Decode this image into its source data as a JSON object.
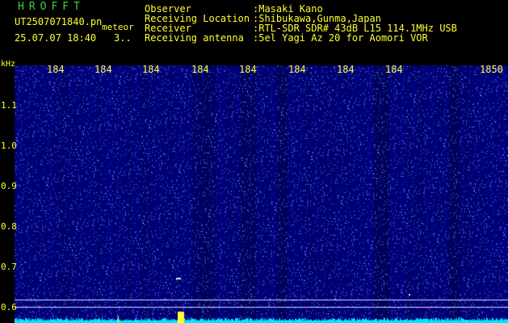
{
  "header": {
    "title": "HROFFT",
    "file_name": "UT2507071840.pn",
    "mode": "meteor",
    "datetime": "25.07.07 18:40",
    "count": "3..",
    "fields": [
      {
        "label": "Observer",
        "value": ":Masaki Kano"
      },
      {
        "label": "Receiving Location",
        "value": ":Shibukawa,Gunma,Japan"
      },
      {
        "label": "Receiver",
        "value": ":RTL-SDR SDR# 43dB L15 114.1MHz USB"
      },
      {
        "label": "Receiving antenna",
        "value": ":5el Yagi Az 20 for Aomori VOR"
      }
    ]
  },
  "axes": {
    "y_unit": "kHz",
    "x_ticks": [
      "184",
      "184",
      "184",
      "184",
      "184",
      "184",
      "184",
      "184",
      "1850"
    ],
    "y_ticks": [
      "1.1",
      "1.0",
      "0.9",
      "0.8",
      "0.7",
      "0.6"
    ]
  },
  "colors": {
    "text": "#ffff33",
    "title": "#3fd23f",
    "background": "#00006e",
    "signal": "#00e5ff",
    "grid_line": "#d8d8ff"
  }
}
